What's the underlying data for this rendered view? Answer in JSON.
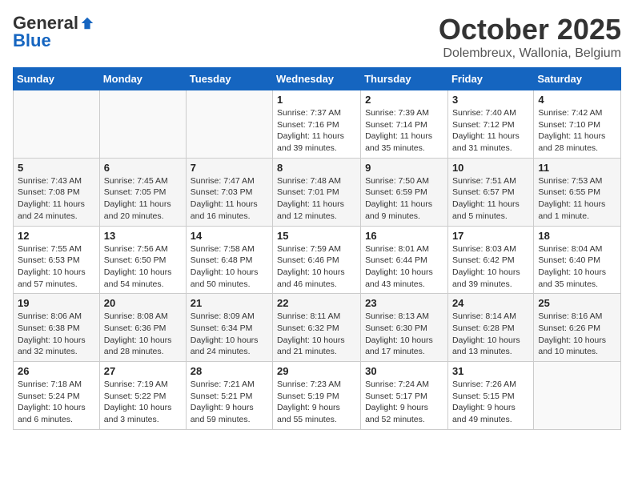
{
  "logo": {
    "general": "General",
    "blue": "Blue"
  },
  "header": {
    "month": "October 2025",
    "location": "Dolembreux, Wallonia, Belgium"
  },
  "weekdays": [
    "Sunday",
    "Monday",
    "Tuesday",
    "Wednesday",
    "Thursday",
    "Friday",
    "Saturday"
  ],
  "weeks": [
    [
      {
        "day": "",
        "info": ""
      },
      {
        "day": "",
        "info": ""
      },
      {
        "day": "",
        "info": ""
      },
      {
        "day": "1",
        "info": "Sunrise: 7:37 AM\nSunset: 7:16 PM\nDaylight: 11 hours\nand 39 minutes."
      },
      {
        "day": "2",
        "info": "Sunrise: 7:39 AM\nSunset: 7:14 PM\nDaylight: 11 hours\nand 35 minutes."
      },
      {
        "day": "3",
        "info": "Sunrise: 7:40 AM\nSunset: 7:12 PM\nDaylight: 11 hours\nand 31 minutes."
      },
      {
        "day": "4",
        "info": "Sunrise: 7:42 AM\nSunset: 7:10 PM\nDaylight: 11 hours\nand 28 minutes."
      }
    ],
    [
      {
        "day": "5",
        "info": "Sunrise: 7:43 AM\nSunset: 7:08 PM\nDaylight: 11 hours\nand 24 minutes."
      },
      {
        "day": "6",
        "info": "Sunrise: 7:45 AM\nSunset: 7:05 PM\nDaylight: 11 hours\nand 20 minutes."
      },
      {
        "day": "7",
        "info": "Sunrise: 7:47 AM\nSunset: 7:03 PM\nDaylight: 11 hours\nand 16 minutes."
      },
      {
        "day": "8",
        "info": "Sunrise: 7:48 AM\nSunset: 7:01 PM\nDaylight: 11 hours\nand 12 minutes."
      },
      {
        "day": "9",
        "info": "Sunrise: 7:50 AM\nSunset: 6:59 PM\nDaylight: 11 hours\nand 9 minutes."
      },
      {
        "day": "10",
        "info": "Sunrise: 7:51 AM\nSunset: 6:57 PM\nDaylight: 11 hours\nand 5 minutes."
      },
      {
        "day": "11",
        "info": "Sunrise: 7:53 AM\nSunset: 6:55 PM\nDaylight: 11 hours\nand 1 minute."
      }
    ],
    [
      {
        "day": "12",
        "info": "Sunrise: 7:55 AM\nSunset: 6:53 PM\nDaylight: 10 hours\nand 57 minutes."
      },
      {
        "day": "13",
        "info": "Sunrise: 7:56 AM\nSunset: 6:50 PM\nDaylight: 10 hours\nand 54 minutes."
      },
      {
        "day": "14",
        "info": "Sunrise: 7:58 AM\nSunset: 6:48 PM\nDaylight: 10 hours\nand 50 minutes."
      },
      {
        "day": "15",
        "info": "Sunrise: 7:59 AM\nSunset: 6:46 PM\nDaylight: 10 hours\nand 46 minutes."
      },
      {
        "day": "16",
        "info": "Sunrise: 8:01 AM\nSunset: 6:44 PM\nDaylight: 10 hours\nand 43 minutes."
      },
      {
        "day": "17",
        "info": "Sunrise: 8:03 AM\nSunset: 6:42 PM\nDaylight: 10 hours\nand 39 minutes."
      },
      {
        "day": "18",
        "info": "Sunrise: 8:04 AM\nSunset: 6:40 PM\nDaylight: 10 hours\nand 35 minutes."
      }
    ],
    [
      {
        "day": "19",
        "info": "Sunrise: 8:06 AM\nSunset: 6:38 PM\nDaylight: 10 hours\nand 32 minutes."
      },
      {
        "day": "20",
        "info": "Sunrise: 8:08 AM\nSunset: 6:36 PM\nDaylight: 10 hours\nand 28 minutes."
      },
      {
        "day": "21",
        "info": "Sunrise: 8:09 AM\nSunset: 6:34 PM\nDaylight: 10 hours\nand 24 minutes."
      },
      {
        "day": "22",
        "info": "Sunrise: 8:11 AM\nSunset: 6:32 PM\nDaylight: 10 hours\nand 21 minutes."
      },
      {
        "day": "23",
        "info": "Sunrise: 8:13 AM\nSunset: 6:30 PM\nDaylight: 10 hours\nand 17 minutes."
      },
      {
        "day": "24",
        "info": "Sunrise: 8:14 AM\nSunset: 6:28 PM\nDaylight: 10 hours\nand 13 minutes."
      },
      {
        "day": "25",
        "info": "Sunrise: 8:16 AM\nSunset: 6:26 PM\nDaylight: 10 hours\nand 10 minutes."
      }
    ],
    [
      {
        "day": "26",
        "info": "Sunrise: 7:18 AM\nSunset: 5:24 PM\nDaylight: 10 hours\nand 6 minutes."
      },
      {
        "day": "27",
        "info": "Sunrise: 7:19 AM\nSunset: 5:22 PM\nDaylight: 10 hours\nand 3 minutes."
      },
      {
        "day": "28",
        "info": "Sunrise: 7:21 AM\nSunset: 5:21 PM\nDaylight: 9 hours\nand 59 minutes."
      },
      {
        "day": "29",
        "info": "Sunrise: 7:23 AM\nSunset: 5:19 PM\nDaylight: 9 hours\nand 55 minutes."
      },
      {
        "day": "30",
        "info": "Sunrise: 7:24 AM\nSunset: 5:17 PM\nDaylight: 9 hours\nand 52 minutes."
      },
      {
        "day": "31",
        "info": "Sunrise: 7:26 AM\nSunset: 5:15 PM\nDaylight: 9 hours\nand 49 minutes."
      },
      {
        "day": "",
        "info": ""
      }
    ]
  ]
}
